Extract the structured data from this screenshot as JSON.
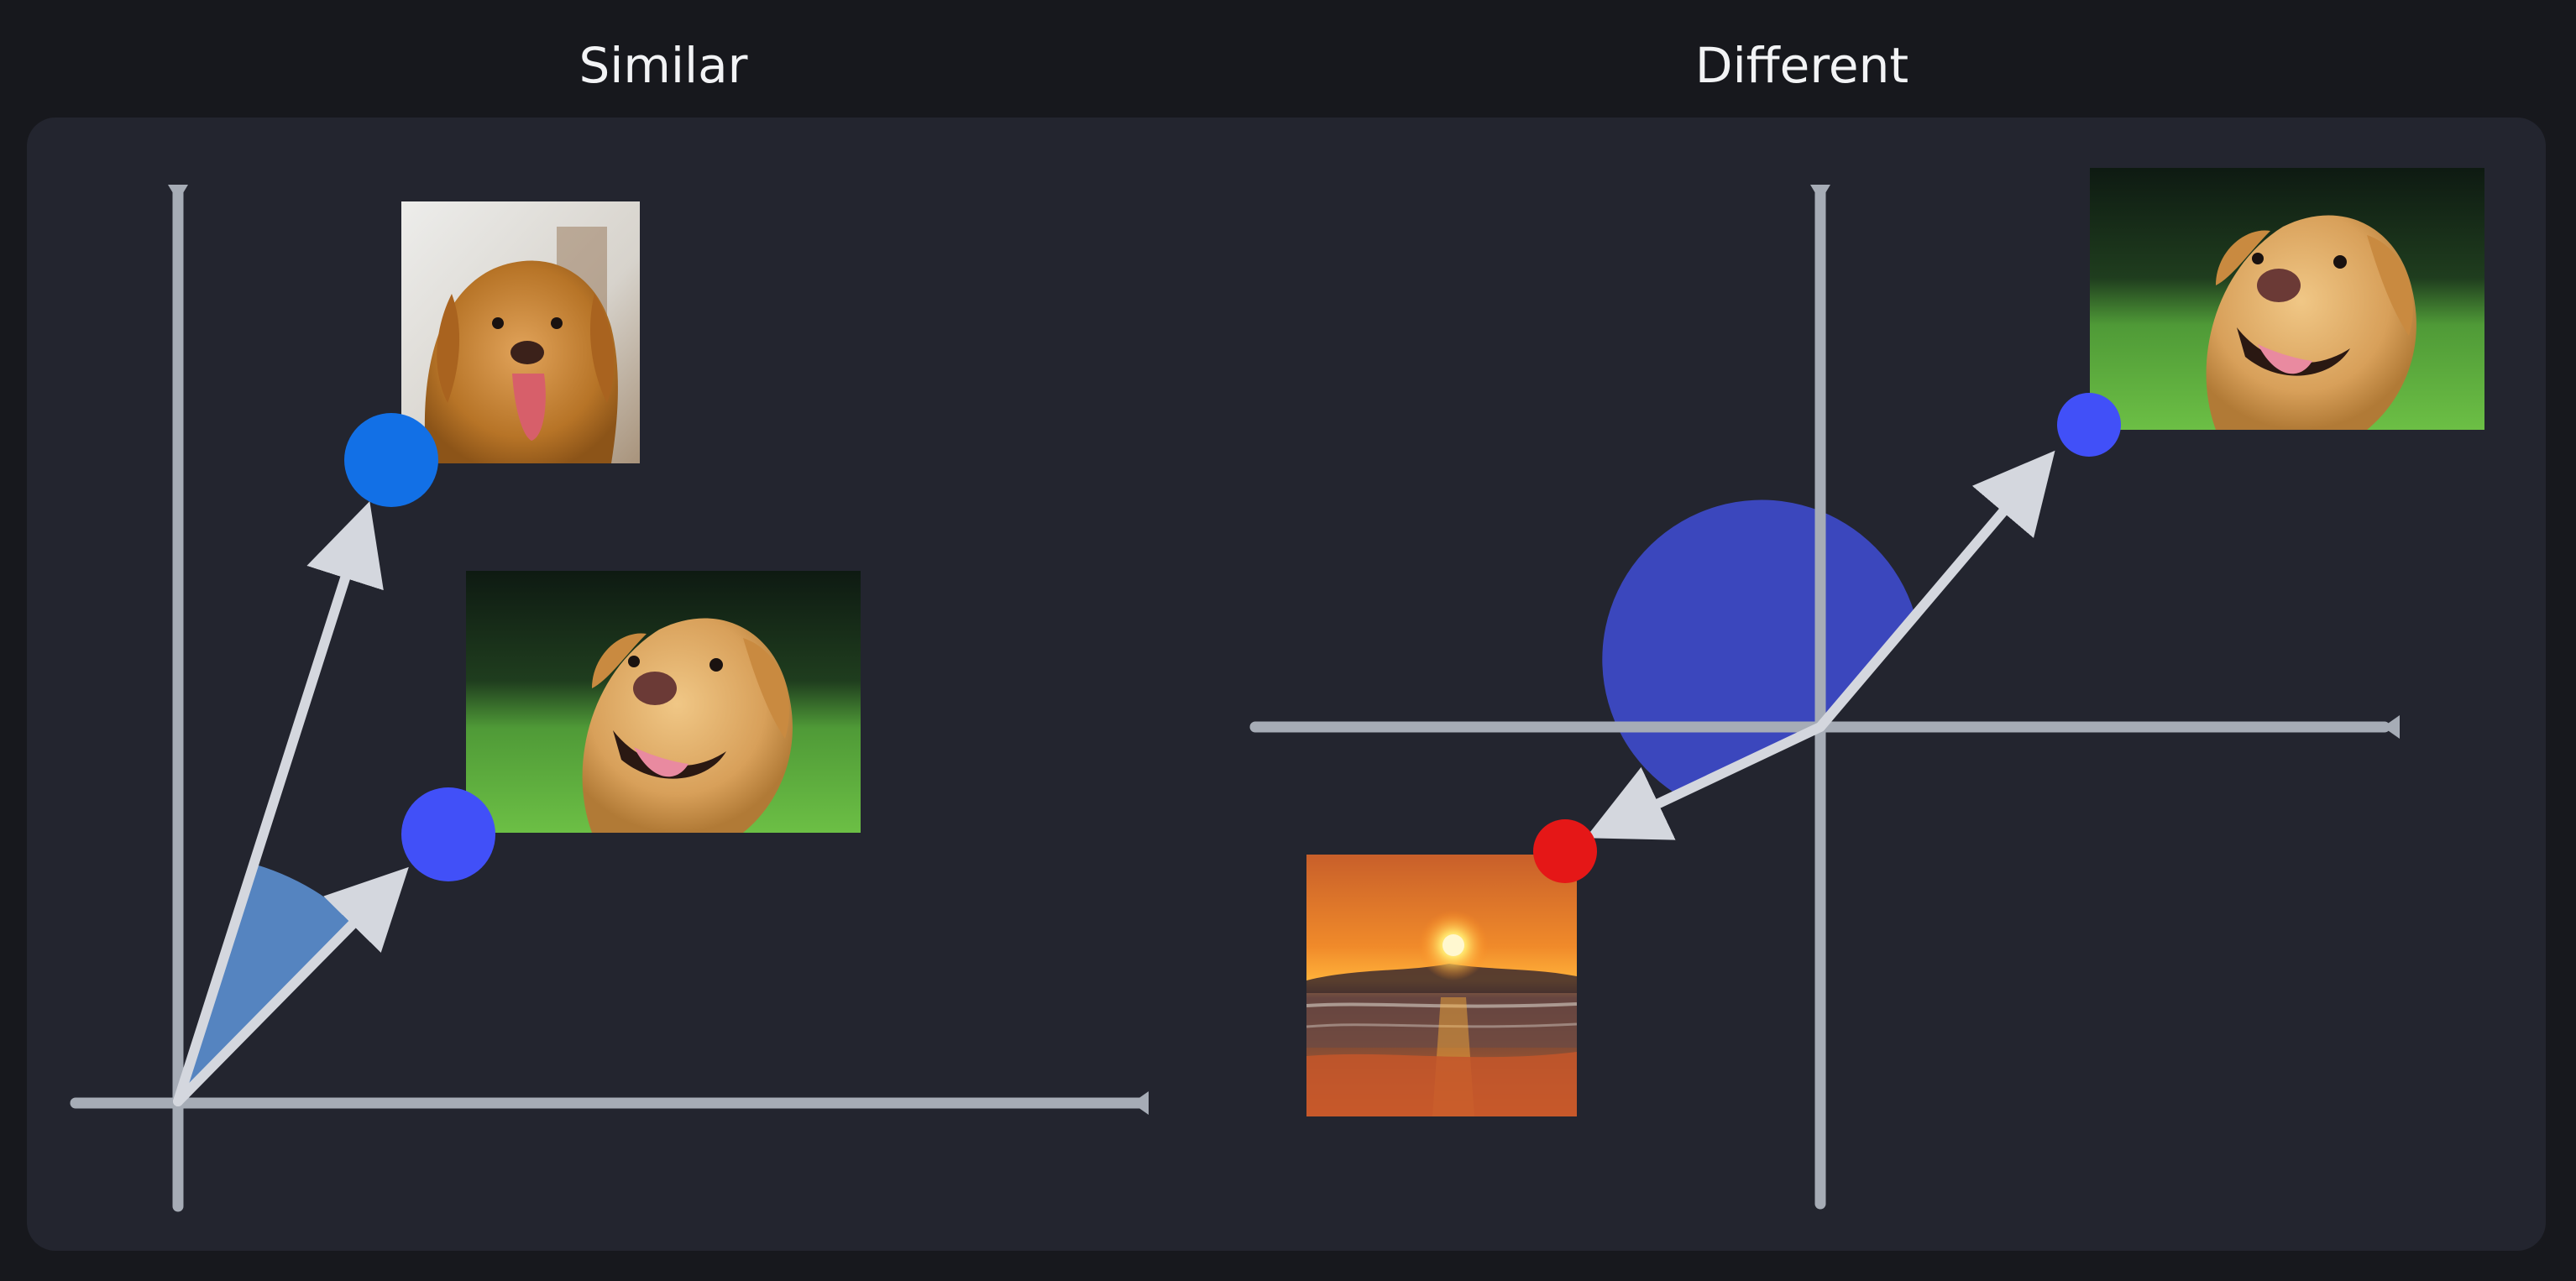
{
  "headings": {
    "left": "Similar",
    "right": "Different"
  },
  "colors": {
    "page_background": "#17181d",
    "panel": "#23252f",
    "axis": "#a6acb6",
    "vector": "#d4d7de",
    "angle_similar": "#5b8fd0",
    "angle_different": "#3f4ed6",
    "point_dog_1": "#1270e6",
    "point_dog_2": "#4150f8",
    "point_sunset": "#e51717"
  },
  "figures": {
    "similar": {
      "images": [
        {
          "name": "golden-retriever-tongue-out-photo",
          "subject": "dog"
        },
        {
          "name": "labrador-on-grass-photo",
          "subject": "dog"
        }
      ],
      "angle": "small"
    },
    "different": {
      "images": [
        {
          "name": "labrador-on-grass-photo",
          "subject": "dog"
        },
        {
          "name": "sunset-beach-photo",
          "subject": "sunset"
        }
      ],
      "angle": "large"
    }
  }
}
